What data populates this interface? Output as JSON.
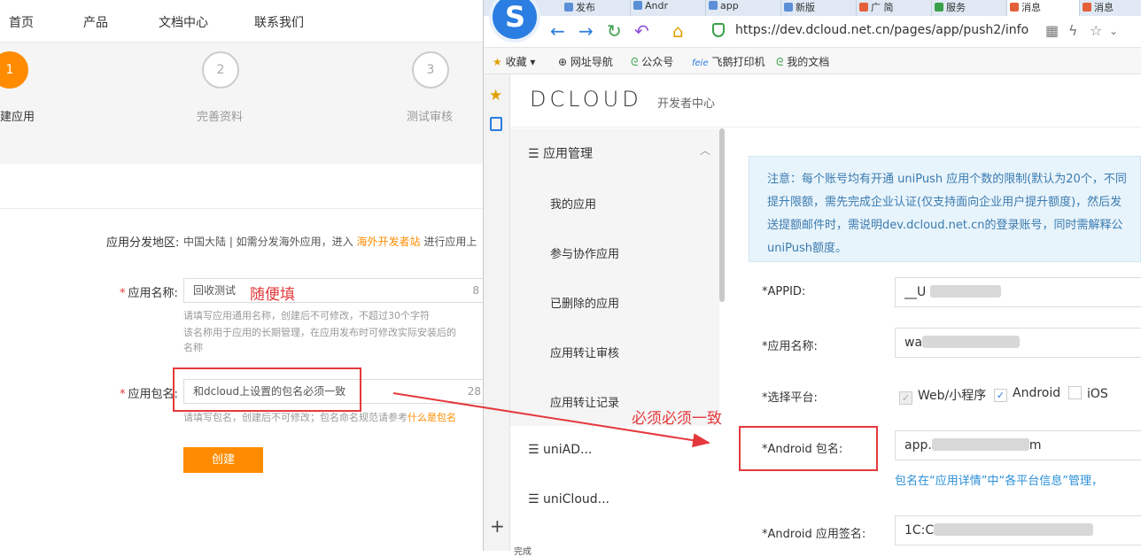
{
  "left_page": {
    "nav": [
      "首页",
      "产品",
      "文档中心",
      "联系我们"
    ],
    "steps": [
      {
        "number": "1",
        "label": "建应用"
      },
      {
        "number": "2",
        "label": "完善资料"
      },
      {
        "number": "3",
        "label": "测试审核"
      }
    ],
    "region": {
      "label": "应用分发地区:",
      "text": "中国大陆 | 如需分发海外应用，进入",
      "link": "海外开发者站",
      "suffix": "进行应用上"
    },
    "app_name": {
      "required": "*",
      "label": "应用名称:",
      "value": "回收测试",
      "counter": "8",
      "hint_line1": "请填写应用通用名称，创建后不可修改，不超过30个字符",
      "hint_line2": "该名称用于应用的长期管理，在应用发布时可修改实际安装后的",
      "hint_line3": "名称"
    },
    "package_name": {
      "required": "*",
      "label": "应用包名:",
      "value": "和dcloud上设置的包名必须一致",
      "counter": "28",
      "hint": "请填写包名，创建后不可修改；包名命名规范请参考",
      "hint_link": "什么是包名"
    },
    "create_button": "创建",
    "annotation_fill": "随便填",
    "annotation_match": "必须必须一致"
  },
  "browser": {
    "tabs": [
      {
        "label": "发布",
        "color": "#5a8fd8"
      },
      {
        "label": "Andr",
        "color": "#5a8fd8"
      },
      {
        "label": "app",
        "color": "#5a8fd8"
      },
      {
        "label": "新版",
        "color": "#5a8fd8"
      },
      {
        "label": "广 简",
        "color": "#e4603a"
      },
      {
        "label": "服务",
        "color": "#3aa04a"
      },
      {
        "label": "消息",
        "color": "#e4603a"
      },
      {
        "label": "消息",
        "color": "#e4603a"
      }
    ],
    "url": "https://dev.dcloud.net.cn/pages/app/push2/info",
    "bookmarks": [
      "收藏",
      "网址导航",
      "公众号",
      "飞鹅打印机",
      "我的文档"
    ],
    "status": "完成"
  },
  "dcloud": {
    "logo": "DCLOUD",
    "subtitle": "开发者中心",
    "sidebar": {
      "group1": "应用管理",
      "items": [
        "我的应用",
        "参与协作应用",
        "已删除的应用",
        "应用转让审核",
        "应用转让记录"
      ],
      "group2": "uniAD...",
      "group3": "uniCloud..."
    },
    "notice": [
      "注意：每个账号均有开通 uniPush 应用个数的限制(默认为20个，不同",
      "提升限额，需先完成企业认证(仅支持面向企业用户提升额度)，然后发",
      "送提额邮件时，需说明dev.dcloud.net.cn的登录账号，同时需解释公",
      "uniPush额度。"
    ],
    "form": {
      "appid_label": "*APPID:",
      "appid_value": "__U",
      "name_label": "*应用名称:",
      "name_value": "wa",
      "platform_label": "*选择平台:",
      "platforms": [
        {
          "label": "Web/小程序",
          "state": "disabled"
        },
        {
          "label": "Android",
          "state": "checked"
        },
        {
          "label": "iOS",
          "state": "unchecked"
        }
      ],
      "android_pkg_label": "*Android 包名:",
      "android_pkg_value": "app.",
      "android_pkg_value_end": "m",
      "pkg_link": "包名在“应用详情”中“各平台信息”管理，",
      "android_sig_label": "*Android 应用签名:",
      "android_sig_value": "1C:C"
    }
  },
  "colors": {
    "accent_orange": "#ff8c00",
    "annotation_red": "#e4393c",
    "link_blue": "#2a8fd8",
    "notice_bg": "#e8f4fb"
  }
}
